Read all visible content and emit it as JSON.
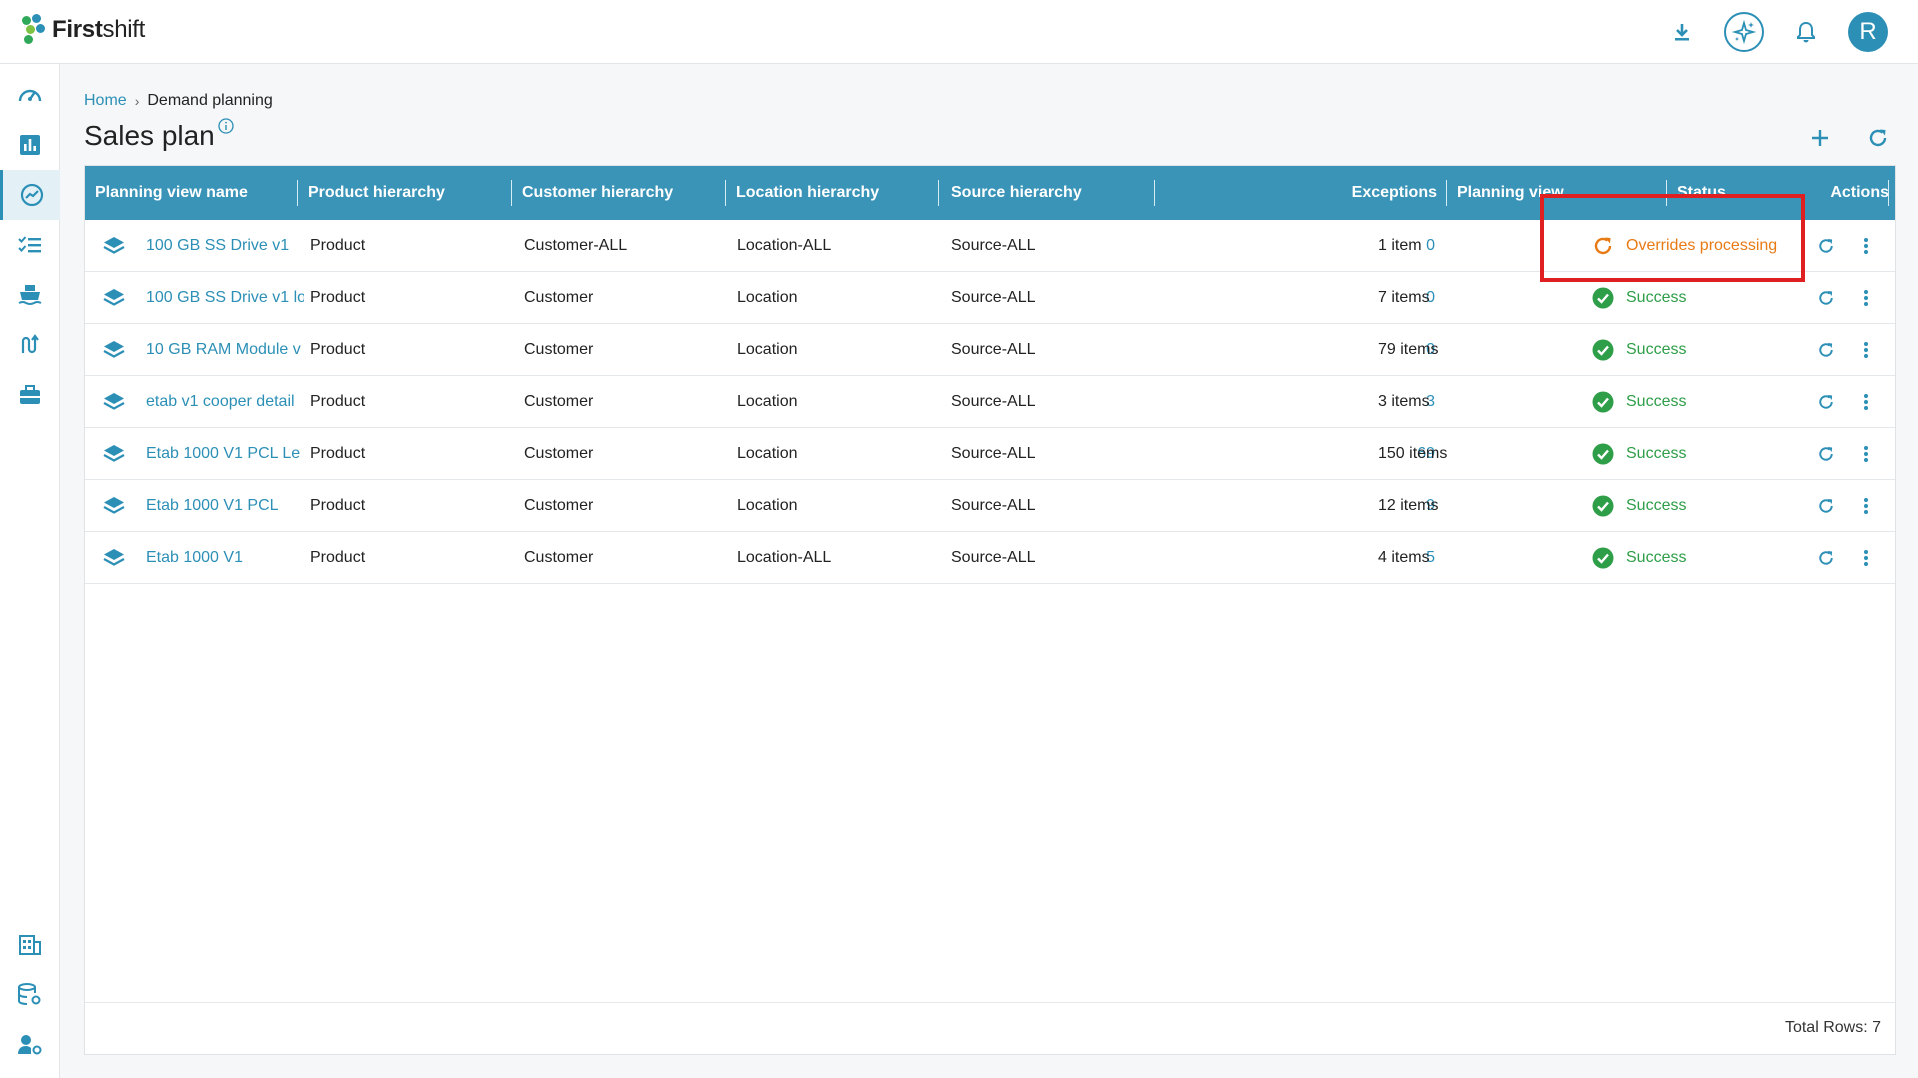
{
  "app": {
    "brand_bold": "First",
    "brand_light": "shift",
    "avatar_letter": "R"
  },
  "breadcrumb": {
    "home": "Home",
    "separator": "›",
    "current": "Demand planning"
  },
  "page": {
    "title": "Sales plan"
  },
  "table": {
    "headers": [
      "Planning view name",
      "Product hierarchy",
      "Customer hierarchy",
      "Location hierarchy",
      "Source hierarchy",
      "Exceptions",
      "Planning view",
      "Status",
      "Actions"
    ],
    "rows": [
      {
        "name": "100 GB SS Drive v1",
        "product": "Product",
        "customer": "Customer-ALL",
        "location": "Location-ALL",
        "source": "Source-ALL",
        "exceptions": "0",
        "view": "1 item",
        "status": "Overrides processing",
        "state": "processing"
      },
      {
        "name": "100 GB SS Drive v1 lo",
        "product": "Product",
        "customer": "Customer",
        "location": "Location",
        "source": "Source-ALL",
        "exceptions": "0",
        "view": "7 items",
        "status": "Success",
        "state": "ok"
      },
      {
        "name": "10 GB RAM Module v",
        "product": "Product",
        "customer": "Customer",
        "location": "Location",
        "source": "Source-ALL",
        "exceptions": "0",
        "view": "79 items",
        "status": "Success",
        "state": "ok"
      },
      {
        "name": "etab v1 cooper detail",
        "product": "Product",
        "customer": "Customer",
        "location": "Location",
        "source": "Source-ALL",
        "exceptions": "3",
        "view": "3 items",
        "status": "Success",
        "state": "ok"
      },
      {
        "name": "Etab 1000 V1 PCL Le",
        "product": "Product",
        "customer": "Customer",
        "location": "Location",
        "source": "Source-ALL",
        "exceptions": "69",
        "view": "150 items",
        "status": "Success",
        "state": "ok"
      },
      {
        "name": "Etab 1000 V1 PCL",
        "product": "Product",
        "customer": "Customer",
        "location": "Location",
        "source": "Source-ALL",
        "exceptions": "9",
        "view": "12 items",
        "status": "Success",
        "state": "ok"
      },
      {
        "name": "Etab 1000 V1",
        "product": "Product",
        "customer": "Customer",
        "location": "Location-ALL",
        "source": "Source-ALL",
        "exceptions": "5",
        "view": "4 items",
        "status": "Success",
        "state": "ok"
      }
    ],
    "total_rows": "Total Rows: 7"
  },
  "colors": {
    "accent": "#2c8fb6",
    "header_bg": "#3a94b8",
    "success": "#2e9e48",
    "processing": "#e87a14",
    "highlight": "#e02020"
  },
  "icons": {
    "top": [
      "download-icon",
      "ai-sparkle-icon",
      "bell-icon"
    ],
    "sidebar": [
      "dashboard-icon",
      "reports-icon",
      "demand-planning-icon",
      "tasks-icon",
      "shipping-icon",
      "flow-icon",
      "toolbox-icon",
      "building-icon",
      "database-settings-icon",
      "user-settings-icon"
    ]
  }
}
